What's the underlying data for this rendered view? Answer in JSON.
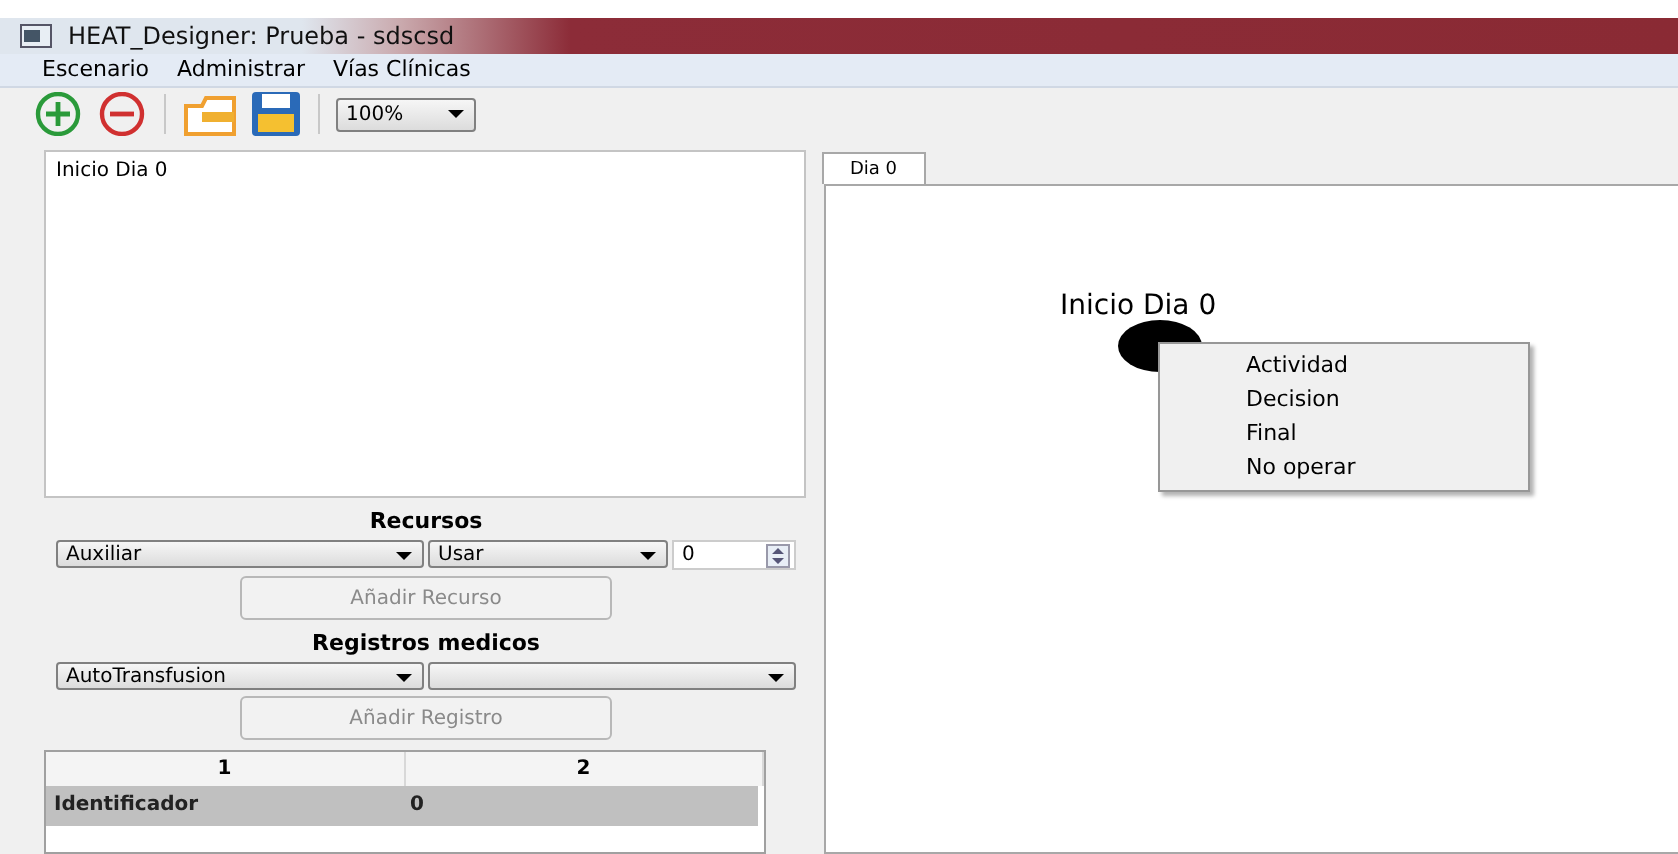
{
  "window": {
    "title": "HEAT_Designer: Prueba - sdscsd"
  },
  "menu_bar": [
    "Escenario",
    "Administrar",
    "Vías Clínicas"
  ],
  "toolbar": {
    "zoom": "100%"
  },
  "scenario_list": {
    "items": [
      {
        "label": "Inicio Dia 0",
        "selected": false
      }
    ]
  },
  "resources": {
    "title": "Recursos",
    "resource": "Auxiliar",
    "action": "Usar",
    "quantity": "0",
    "button": {
      "label": "Añadir Recurso",
      "disabled": true
    }
  },
  "medical_records": {
    "title": "Registros medicos",
    "record": "AutoTransfusion",
    "button": {
      "label": "Añadir Registro",
      "disabled": true
    }
  },
  "table": {
    "columns": [
      "1",
      "2"
    ],
    "rows": [
      {
        "cells": [
          "Identificador",
          "0"
        ],
        "selected": true
      }
    ]
  },
  "tabs": [
    {
      "label": "Dia 0",
      "selected": true
    }
  ],
  "canvas": {
    "nodes": [
      {
        "kind": "start",
        "label": "Inicio Dia 0"
      }
    ]
  },
  "context_menu": {
    "items": [
      "Actividad",
      "Decision",
      "Final",
      "No operar"
    ]
  }
}
